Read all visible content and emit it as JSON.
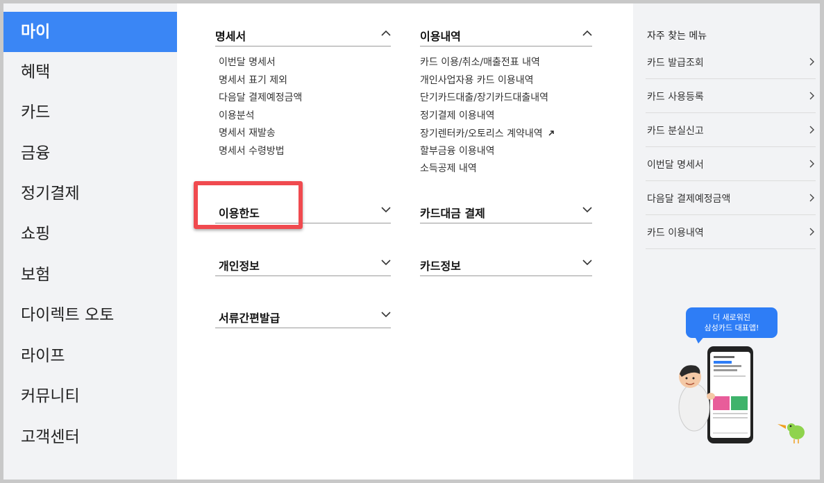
{
  "nav": {
    "items": [
      {
        "label": "마이",
        "active": true
      },
      {
        "label": "혜택"
      },
      {
        "label": "카드"
      },
      {
        "label": "금융"
      },
      {
        "label": "정기결제"
      },
      {
        "label": "쇼핑"
      },
      {
        "label": "보험"
      },
      {
        "label": "다이렉트 오토"
      },
      {
        "label": "라이프"
      },
      {
        "label": "커뮤니티"
      },
      {
        "label": "고객센터"
      }
    ]
  },
  "sections": {
    "statement": {
      "title": "명세서",
      "expanded": true,
      "links": [
        "이번달 명세서",
        "명세서 표기 제외",
        "다음달 결제예정금액",
        "이용분석",
        "명세서 재발송",
        "명세서 수령방법"
      ]
    },
    "usage": {
      "title": "이용내역",
      "expanded": true,
      "links": [
        "카드 이용/취소/매출전표 내역",
        "개인사업자용 카드 이용내역",
        "단기카드대출/장기카드대출내역",
        "정기결제 이용내역",
        "장기렌터카/오토리스 계약내역",
        "할부금융 이용내역",
        "소득공제 내역"
      ]
    },
    "limit": {
      "title": "이용한도",
      "expanded": false
    },
    "payment": {
      "title": "카드대금 결제",
      "expanded": false
    },
    "personal": {
      "title": "개인정보",
      "expanded": false
    },
    "cardinfo": {
      "title": "카드정보",
      "expanded": false
    },
    "docs": {
      "title": "서류간편발급",
      "expanded": false
    }
  },
  "quick": {
    "title": "자주 찾는 메뉴",
    "items": [
      "카드 발급조회",
      "카드 사용등록",
      "카드 분실신고",
      "이번달 명세서",
      "다음달 결제예정금액",
      "카드 이용내역"
    ]
  },
  "promo": {
    "line1": "더 새로워진",
    "line2": "삼성카드 대표앱!",
    "icon": "app-promo-illustration"
  },
  "colors": {
    "accent": "#3a86f5",
    "highlight": "#f04a4f"
  }
}
